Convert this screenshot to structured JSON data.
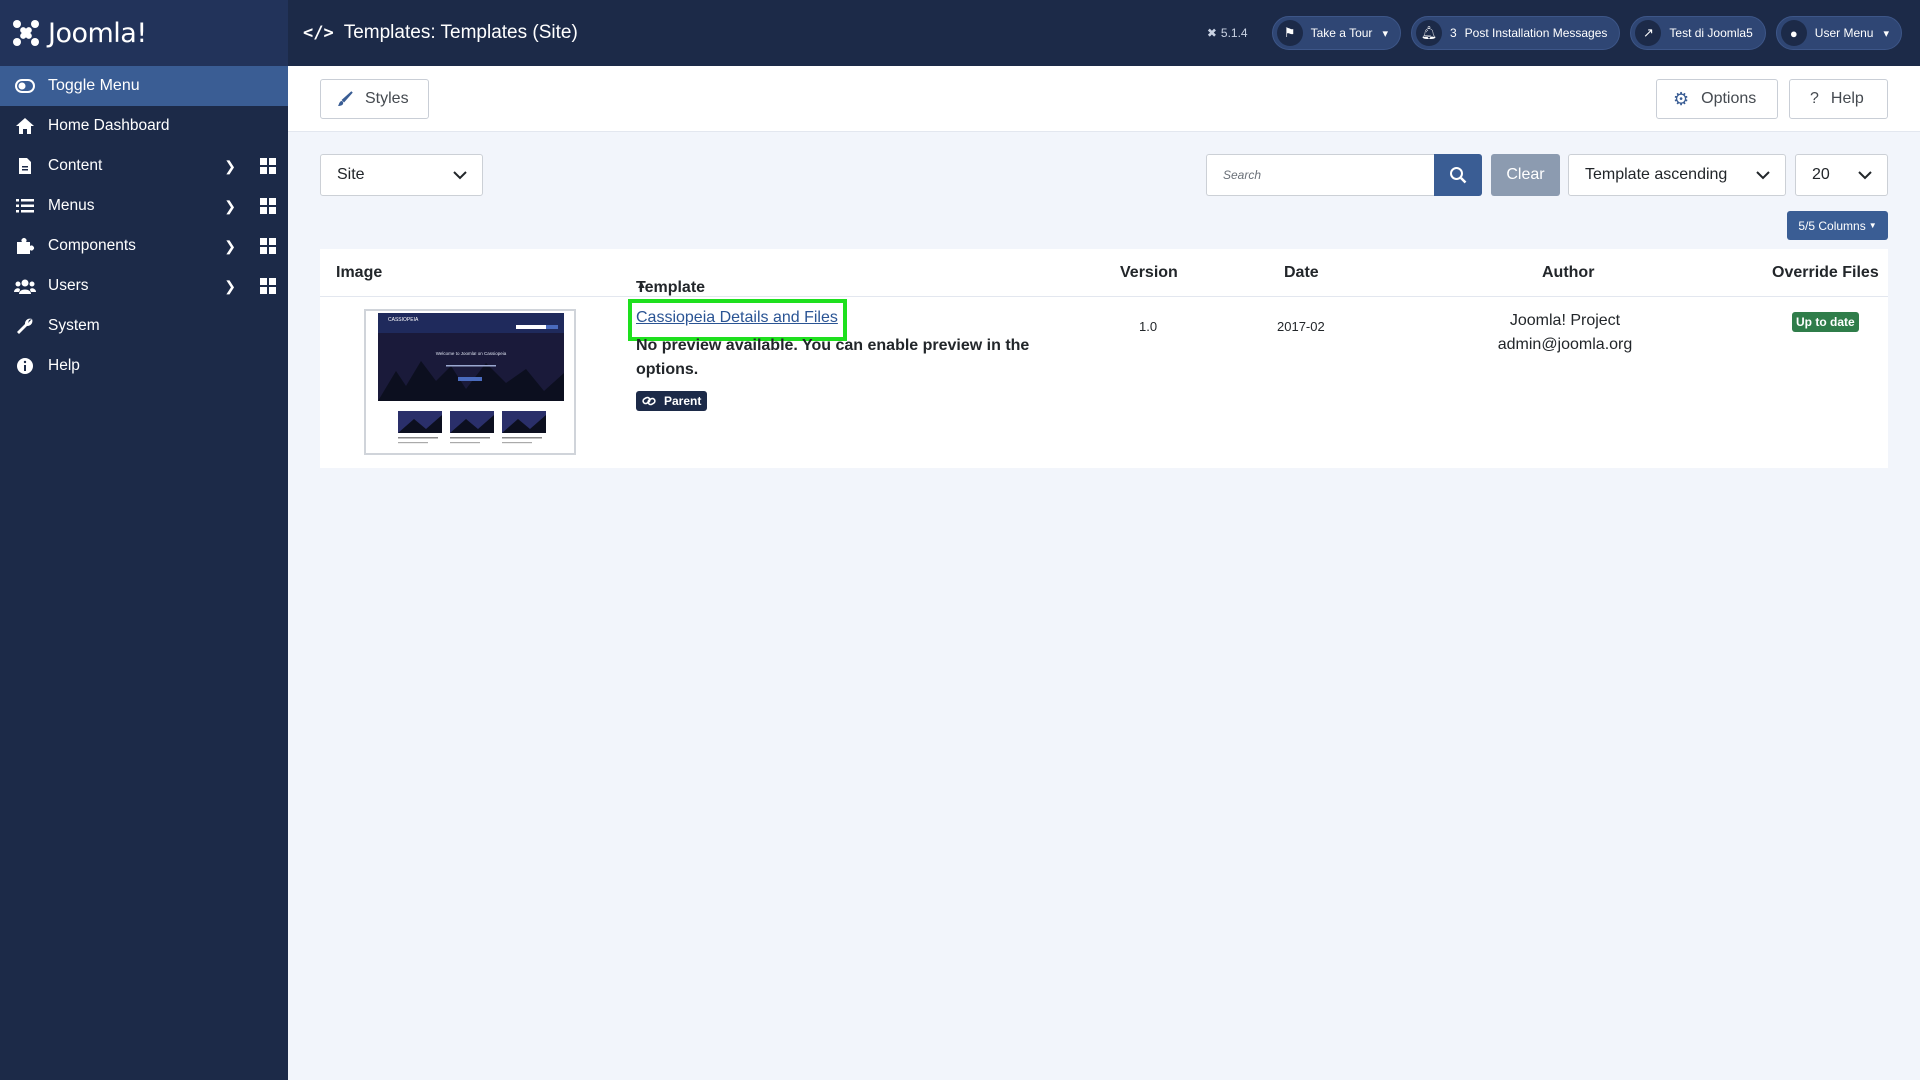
{
  "header": {
    "brand": "Joomla!",
    "title": "Templates: Templates (Site)",
    "version": "5.1.4",
    "tour_label": "Take a Tour",
    "notifications_count": "3",
    "post_install_label": "Post Installation Messages",
    "site_label": "Test di Joomla5",
    "user_menu_label": "User Menu"
  },
  "sidebar": {
    "items": [
      {
        "label": "Toggle Menu"
      },
      {
        "label": "Home Dashboard"
      },
      {
        "label": "Content"
      },
      {
        "label": "Menus"
      },
      {
        "label": "Components"
      },
      {
        "label": "Users"
      },
      {
        "label": "System"
      },
      {
        "label": "Help"
      }
    ]
  },
  "toolbar": {
    "styles_label": "Styles",
    "options_label": "Options",
    "help_label": "Help"
  },
  "filters": {
    "client": "Site",
    "search_placeholder": "Search",
    "clear_label": "Clear",
    "ordering": "Template ascending",
    "limit": "20",
    "columns_label": "5/5 Columns"
  },
  "table": {
    "headers": {
      "image": "Image",
      "template": "Template",
      "version": "Version",
      "date": "Date",
      "author": "Author",
      "override": "Override Files"
    },
    "rows": [
      {
        "thumb_site_name": "CASSIOPEIA",
        "thumb_hero_text": "Welcome to Joomla! on Cassiopeia",
        "link_text": "Cassiopeia Details and Files",
        "description": "No preview available. You can enable preview in the options.",
        "badge": "Parent",
        "version": "1.0",
        "date": "2017-02",
        "author_name": "Joomla! Project",
        "author_email": "admin@joomla.org",
        "override_status": "Up to date"
      }
    ]
  },
  "colors": {
    "sidebar": "#1c2a48",
    "accent": "#3a5d94",
    "highlight": "#1ee01e",
    "success": "#2f7d4a"
  }
}
